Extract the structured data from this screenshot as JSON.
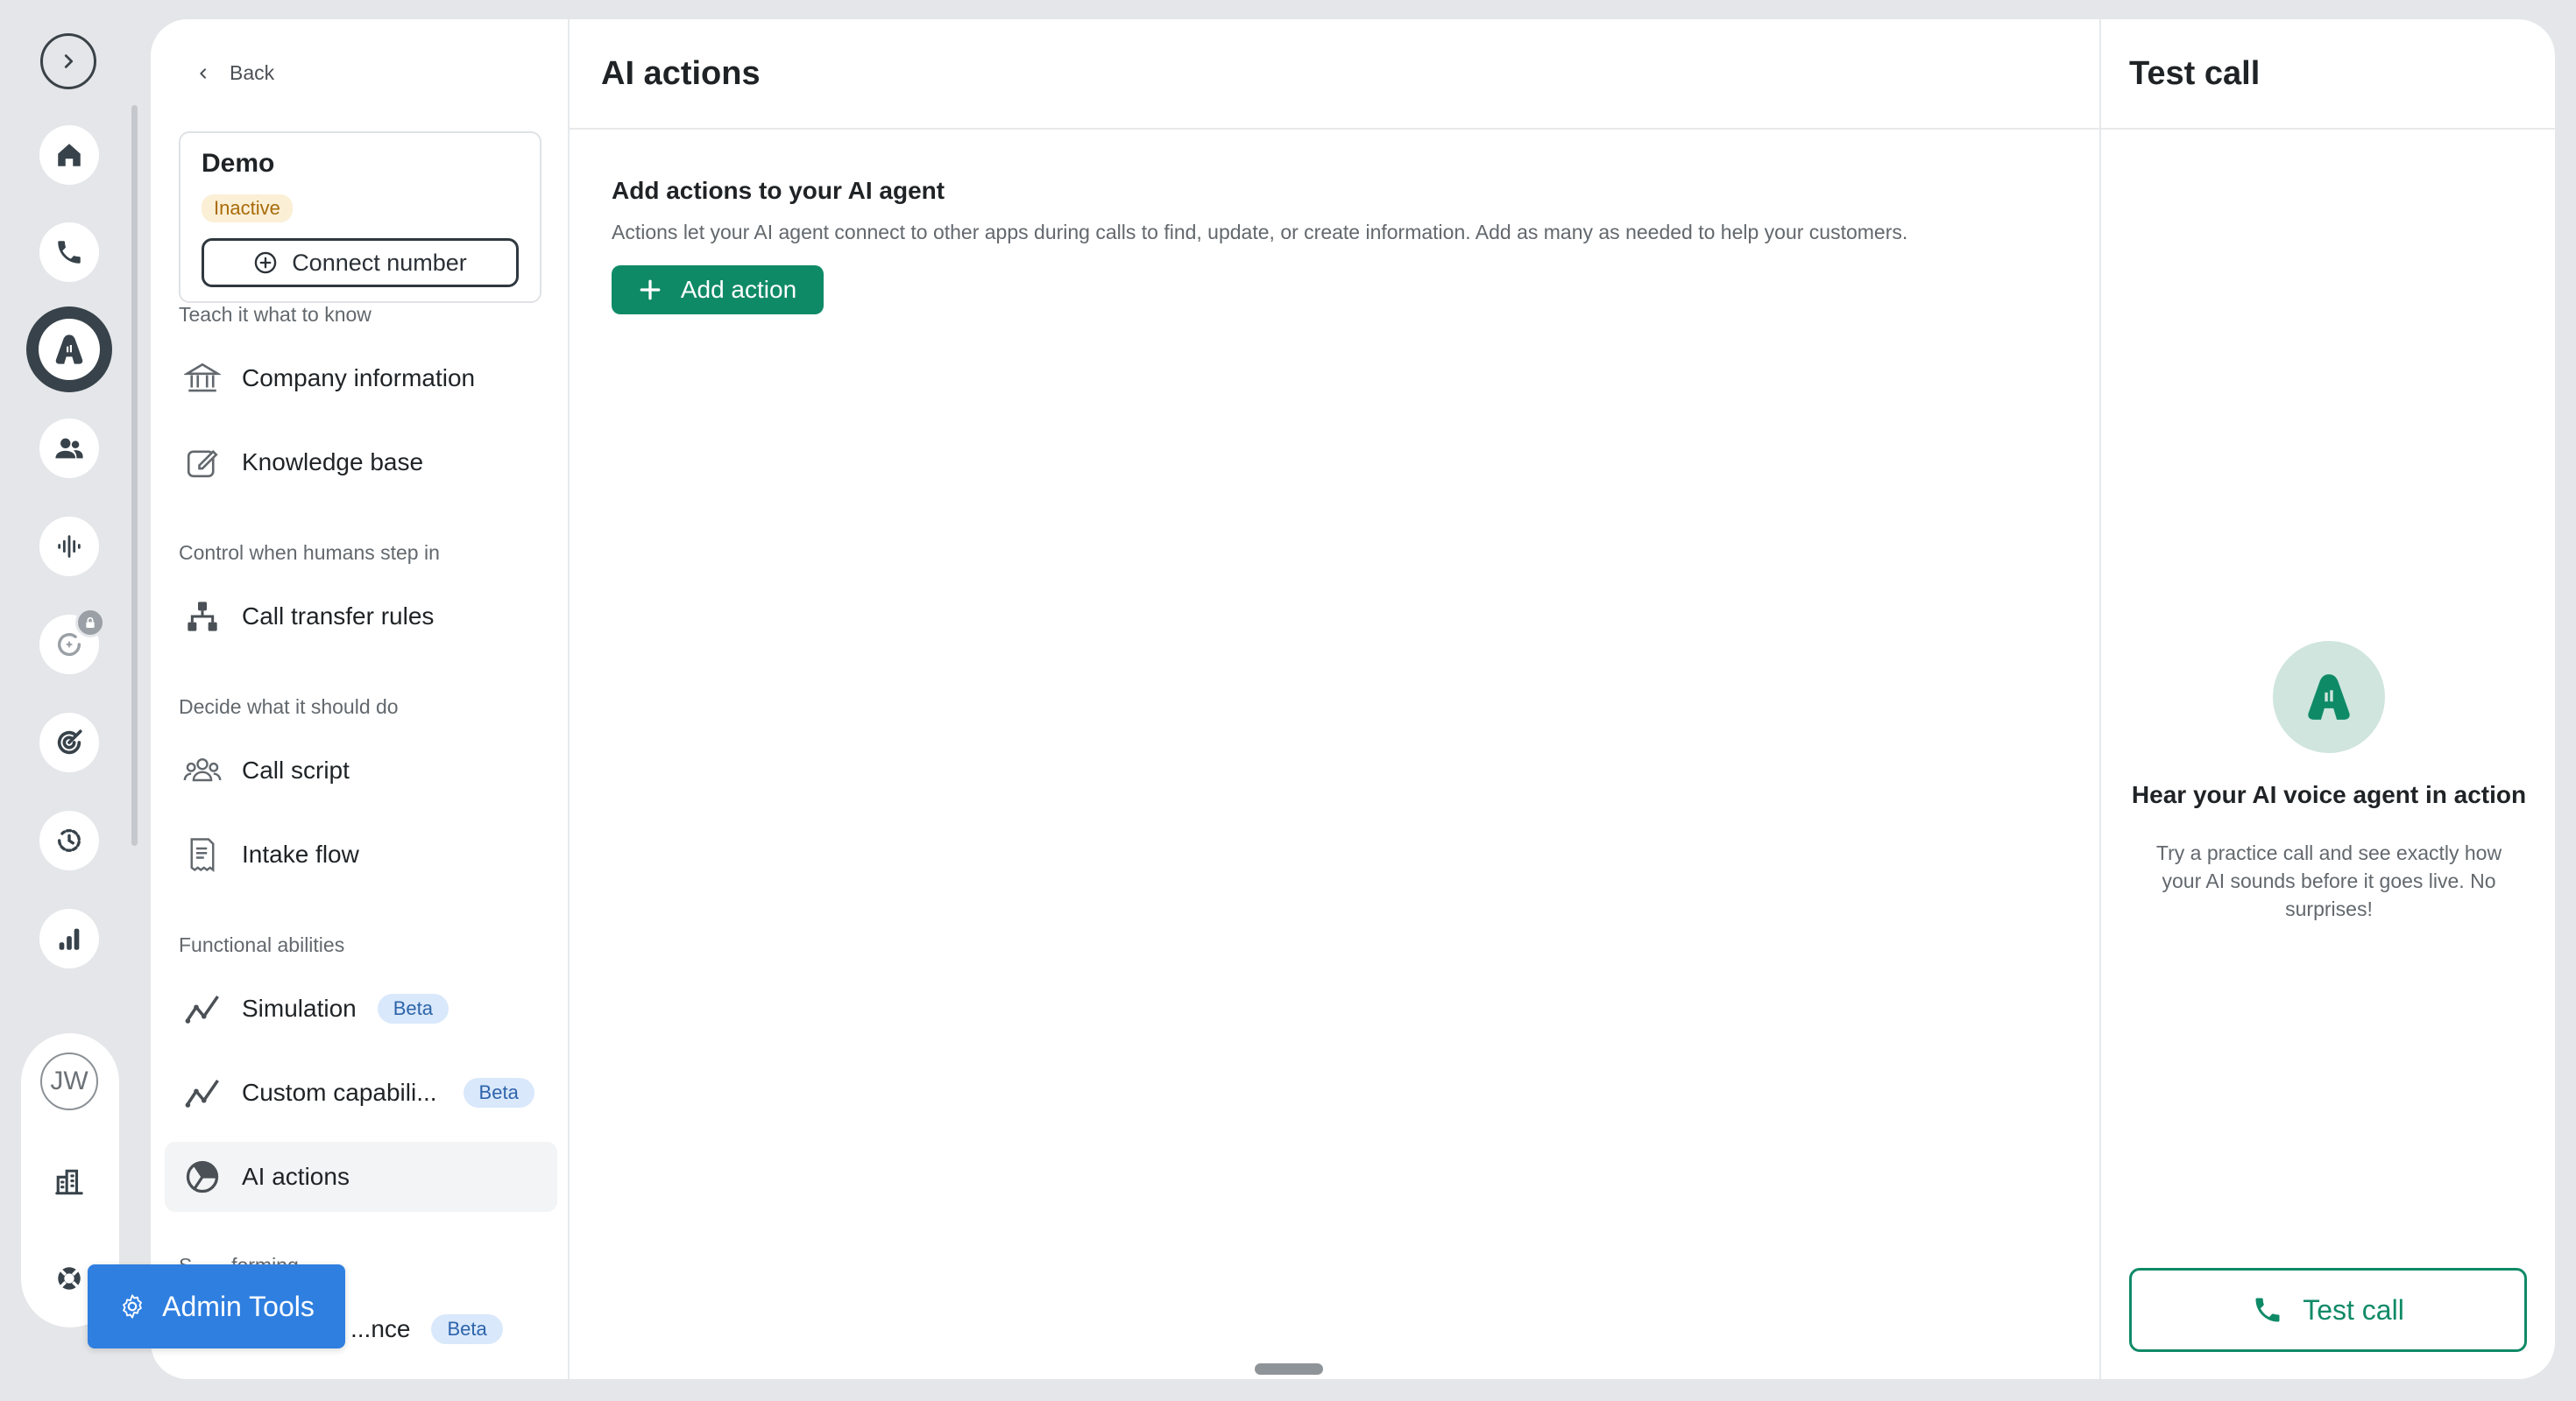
{
  "rail": {
    "avatar_initials": "JW"
  },
  "nav": {
    "back_label": "Back",
    "agent_name": "Demo",
    "agent_status": "Inactive",
    "connect_label": "Connect number",
    "sections": {
      "know": "Teach it what to know",
      "humans": "Control when humans step in",
      "decide": "Decide what it should do",
      "functional": "Functional abilities",
      "partial": "S... ...forming"
    },
    "items": {
      "company": "Company information",
      "knowledge": "Knowledge base",
      "transfer": "Call transfer rules",
      "script": "Call script",
      "intake": "Intake flow",
      "simulation": "Simulation",
      "custom": "Custom capabili...",
      "ai_actions": "AI actions",
      "partial_item": "...nce"
    },
    "beta_label": "Beta",
    "admin_tools": "Admin Tools"
  },
  "main": {
    "title": "AI actions",
    "subtitle": "Add actions to your AI agent",
    "description": "Actions let your AI agent connect to other apps during calls to find, update, or create information. Add as many as needed to help your customers.",
    "add_action_label": "Add action"
  },
  "side": {
    "title": "Test call",
    "hear_title": "Hear your AI voice agent in action",
    "hear_desc": "Try a practice call and see exactly how your AI sounds before it goes live. No surprises!",
    "test_call_label": "Test call"
  },
  "colors": {
    "accent_green": "#0f8a67",
    "admin_blue": "#2f7fe0",
    "beta_bg": "#d9e8fb",
    "inactive_bg": "#fbefd6"
  }
}
